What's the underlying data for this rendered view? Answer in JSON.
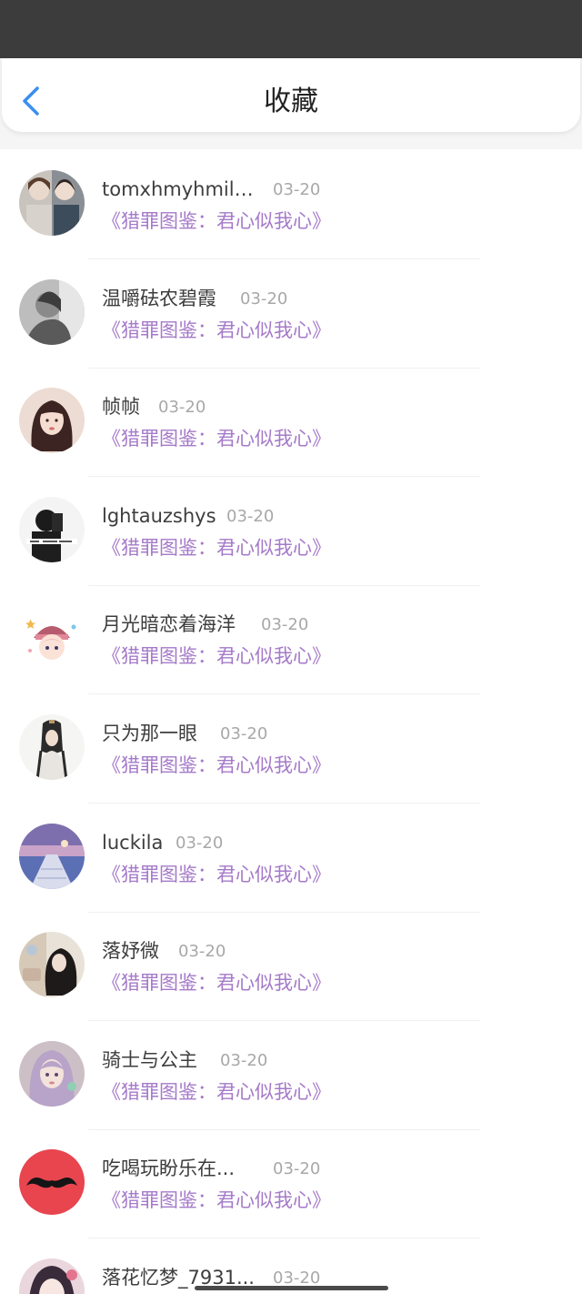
{
  "header": {
    "title": "收藏",
    "back_icon": "chevron-left-icon",
    "accent": "#3a8ef0"
  },
  "theme": {
    "link_color": "#a57ac9",
    "date_color": "#a8a8a8",
    "name_color": "#3d3d3d",
    "status_bar": "#3c3c3c"
  },
  "favorites": [
    {
      "name": "tomxhmyhmilfi...",
      "date": "03-20",
      "book": "《猎罪图鉴：君心似我心》",
      "avatar": "couple-photo-avatar"
    },
    {
      "name": "温嚼砝农碧霞",
      "date": "03-20",
      "book": "《猎罪图鉴：君心似我心》",
      "avatar": "grayscale-portrait-avatar"
    },
    {
      "name": "帧帧",
      "date": "03-20",
      "book": "《猎罪图鉴：君心似我心》",
      "avatar": "girl-portrait-avatar"
    },
    {
      "name": "lghtauzshys",
      "date": "03-20",
      "book": "《猎罪图鉴：君心似我心》",
      "avatar": "black-white-portrait-avatar"
    },
    {
      "name": "月光暗恋着海洋",
      "date": "03-20",
      "book": "《猎罪图鉴：君心似我心》",
      "avatar": "cartoon-girl-avatar"
    },
    {
      "name": "只为那一眼",
      "date": "03-20",
      "book": "《猎罪图鉴：君心似我心》",
      "avatar": "ancient-costume-avatar"
    },
    {
      "name": "luckila",
      "date": "03-20",
      "book": "《猎罪图鉴：君心似我心》",
      "avatar": "pier-sunset-avatar"
    },
    {
      "name": "落妤微",
      "date": "03-20",
      "book": "《猎罪图鉴：君心似我心》",
      "avatar": "long-hair-girl-avatar"
    },
    {
      "name": "骑士与公主",
      "date": "03-20",
      "book": "《猎罪图鉴：君心似我心》",
      "avatar": "lilac-hair-girl-avatar"
    },
    {
      "name": "吃喝玩盼乐在...",
      "date": "03-20",
      "book": "《猎罪图鉴：君心似我心》",
      "avatar": "mustache-avatar"
    },
    {
      "name": "落花忆梦_7931...",
      "date": "03-20",
      "book": "",
      "avatar": "anime-girl-avatar"
    }
  ]
}
